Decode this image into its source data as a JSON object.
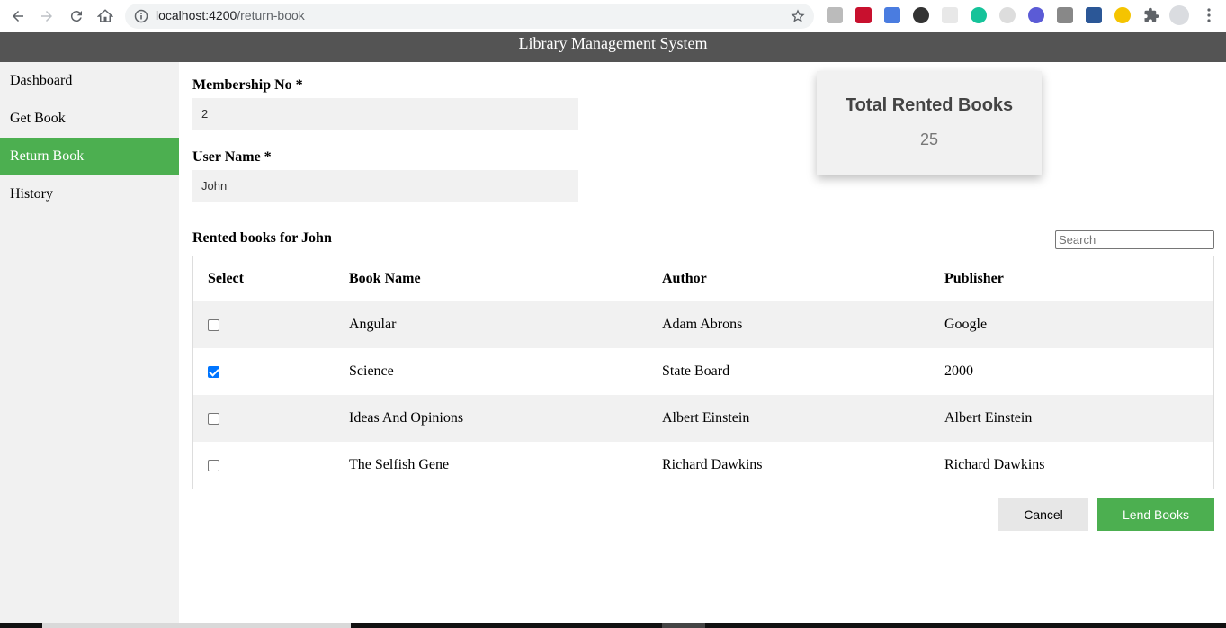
{
  "browser": {
    "url_host": "localhost:4200",
    "url_path": "/return-book"
  },
  "app": {
    "title": "Library Management System"
  },
  "sidebar": {
    "items": [
      {
        "label": "Dashboard",
        "active": false
      },
      {
        "label": "Get Book",
        "active": false
      },
      {
        "label": "Return Book",
        "active": true
      },
      {
        "label": "History",
        "active": false
      }
    ]
  },
  "form": {
    "membership_label": "Membership No *",
    "membership_value": "2",
    "username_label": "User Name *",
    "username_value": "John"
  },
  "stats": {
    "title": "Total Rented Books",
    "value": "25"
  },
  "rented": {
    "heading": "Rented books for John",
    "search_placeholder": "Search",
    "columns": [
      "Select",
      "Book Name",
      "Author",
      "Publisher"
    ],
    "rows": [
      {
        "selected": false,
        "book": "Angular",
        "author": "Adam Abrons",
        "publisher": "Google"
      },
      {
        "selected": true,
        "book": "Science",
        "author": "State Board",
        "publisher": "2000"
      },
      {
        "selected": false,
        "book": "Ideas And Opinions",
        "author": "Albert Einstein",
        "publisher": "Albert Einstein"
      },
      {
        "selected": false,
        "book": "The Selfish Gene",
        "author": "Richard Dawkins",
        "publisher": "Richard Dawkins"
      }
    ]
  },
  "actions": {
    "cancel_label": "Cancel",
    "lend_label": "Lend Books"
  },
  "colors": {
    "accent": "#4caf50",
    "header": "#545454",
    "sidebar_bg": "#f1f1f1"
  }
}
